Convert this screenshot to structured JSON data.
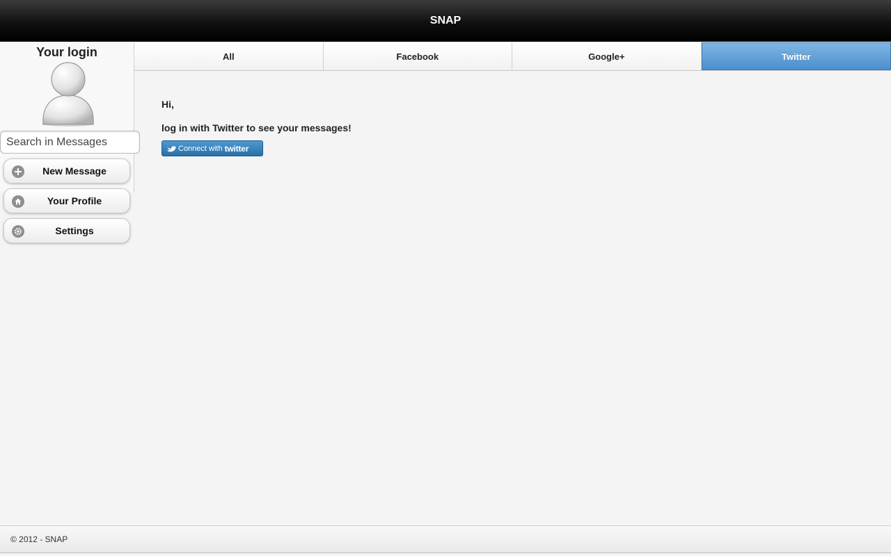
{
  "header": {
    "title": "SNAP"
  },
  "sidebar": {
    "login_title": "Your login",
    "search": {
      "placeholder": "Search in Messages",
      "value": ""
    },
    "buttons": [
      {
        "label": "New Message",
        "icon": "plus-icon"
      },
      {
        "label": "Your Profile",
        "icon": "home-icon"
      },
      {
        "label": "Settings",
        "icon": "gear-icon"
      }
    ]
  },
  "tabs": [
    {
      "label": "All",
      "active": false
    },
    {
      "label": "Facebook",
      "active": false
    },
    {
      "label": "Google+",
      "active": false
    },
    {
      "label": "Twitter",
      "active": true
    }
  ],
  "content": {
    "greeting": "Hi,",
    "message": "log in with Twitter to see your messages!",
    "connect_button": {
      "prefix": "Connect with",
      "brand": "twitter"
    }
  },
  "footer": {
    "text": "© 2012 - SNAP"
  },
  "colors": {
    "active_tab": "#5b9bd5",
    "header_bg": "#1a1a1a",
    "twitter_button": "#2f78b2"
  }
}
